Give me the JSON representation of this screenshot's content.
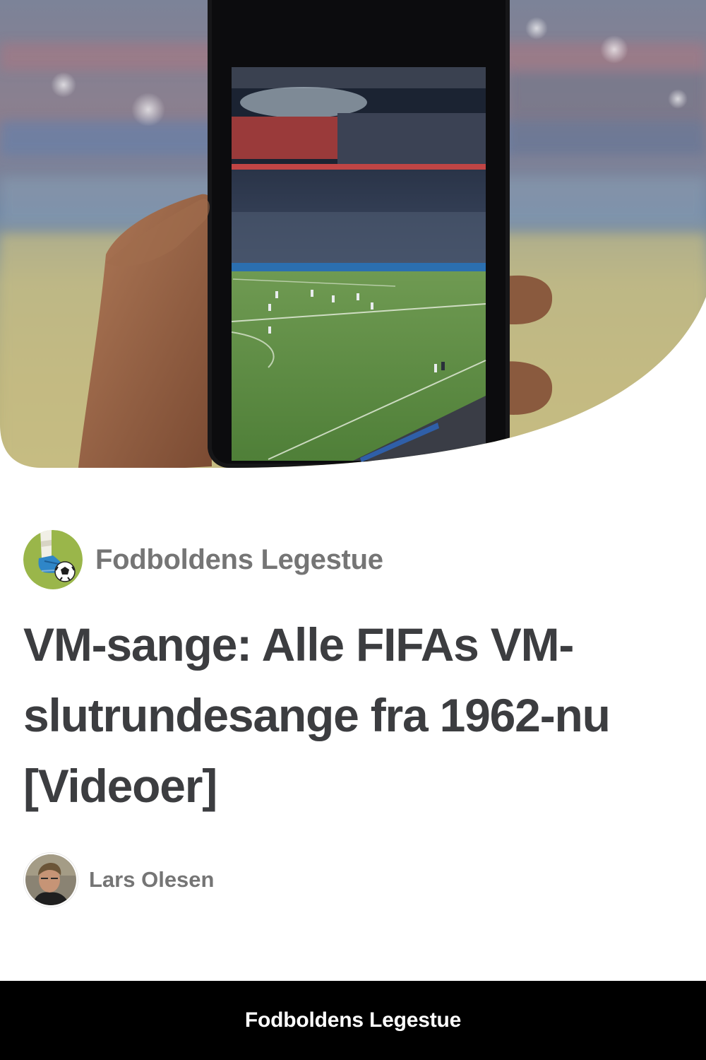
{
  "publisher": {
    "name": "Fodboldens Legestue",
    "logo_icon": "soccer-boot-ball-icon"
  },
  "article": {
    "title": "VM-sange: Alle FIFAs VM-slutrundesange fra 1962-nu [Videoer]",
    "hero_image": "hand-holding-phone-filming-stadium-image"
  },
  "author": {
    "name": "Lars Olesen",
    "avatar_icon": "author-photo-avatar"
  },
  "footer": {
    "label": "Fodboldens Legestue"
  },
  "colors": {
    "title": "#3c3d40",
    "muted": "#757575",
    "footer_bg": "#000000",
    "footer_text": "#ffffff",
    "logo_bg": "#9ab64a"
  }
}
